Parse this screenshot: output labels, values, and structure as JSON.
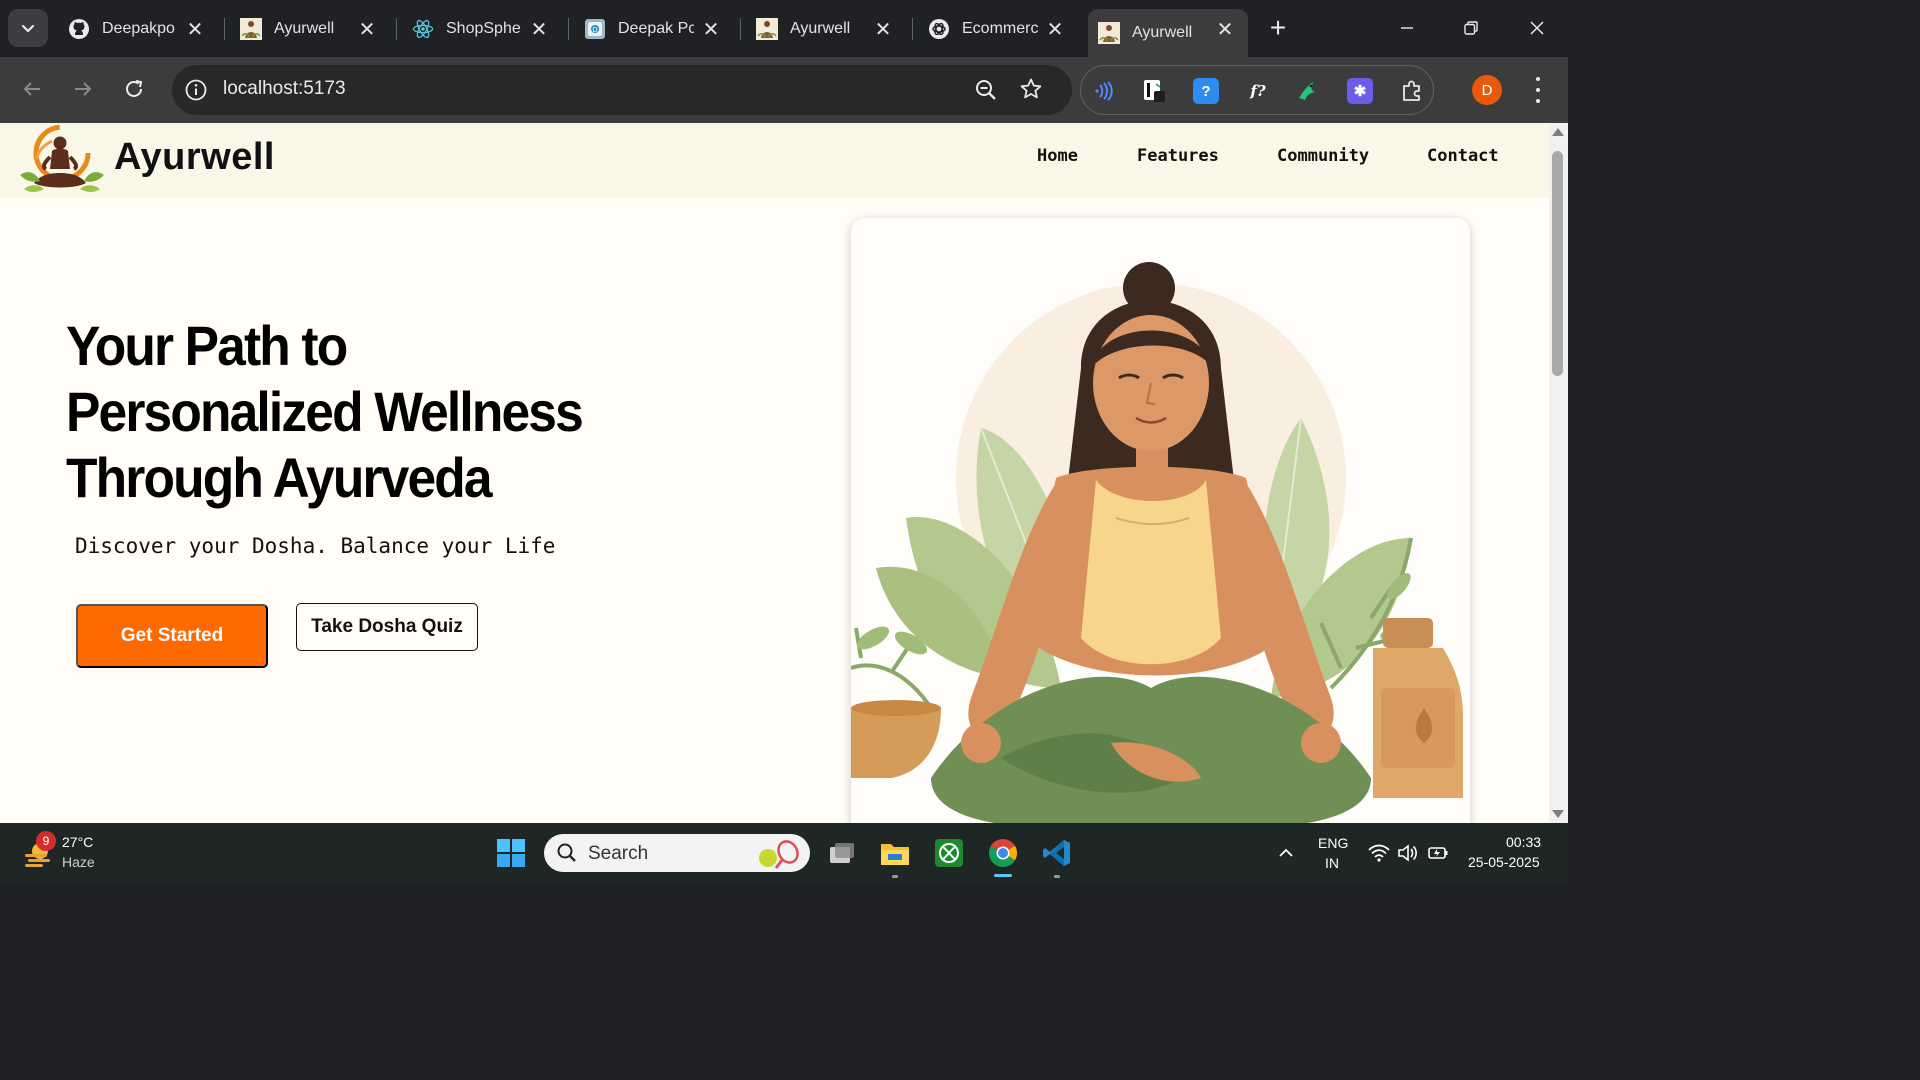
{
  "browser": {
    "tabs": [
      {
        "title": "Deepakpo",
        "favicon": "github-icon"
      },
      {
        "title": "Ayurwell",
        "favicon": "ayurwell-favicon"
      },
      {
        "title": "ShopSphe",
        "favicon": "react-icon"
      },
      {
        "title": "Deepak Pc",
        "favicon": "portfolio-favicon"
      },
      {
        "title": "Ayurwell",
        "favicon": "ayurwell-favicon"
      },
      {
        "title": "Ecommerc",
        "favicon": "chatgpt-icon"
      },
      {
        "title": "Ayurwell",
        "favicon": "ayurwell-favicon",
        "active": true
      }
    ],
    "url": "localhost:5173",
    "profile_initial": "D",
    "extension_icons": [
      "sound-wave-icon",
      "notion-ext-icon",
      "help-ext-icon",
      "formula-ext-icon",
      "bird-ext-icon",
      "snowflake-ext-icon",
      "extensions-puzzle-icon"
    ]
  },
  "site": {
    "brand": "Ayurwell",
    "nav": {
      "home": "Home",
      "features": "Features",
      "community": "Community",
      "contact": "Contact"
    },
    "hero": {
      "title_line1": "Your Path to",
      "title_line2": "Personalized Wellness",
      "title_line3": "Through Ayurveda",
      "subtitle": "Discover your Dosha. Balance your Life",
      "cta_primary": "Get Started",
      "cta_secondary": "Take Dosha Quiz"
    },
    "colors": {
      "accent": "#ff6a00",
      "nav_bg": "#f9f8e8",
      "page_bg": "#fffdf6"
    }
  },
  "taskbar": {
    "weather_badge": "9",
    "temperature": "27°C",
    "weather": "Haze",
    "search_placeholder": "Search",
    "lang_line1": "ENG",
    "lang_line2": "IN",
    "time": "00:33",
    "date": "25-05-2025"
  }
}
